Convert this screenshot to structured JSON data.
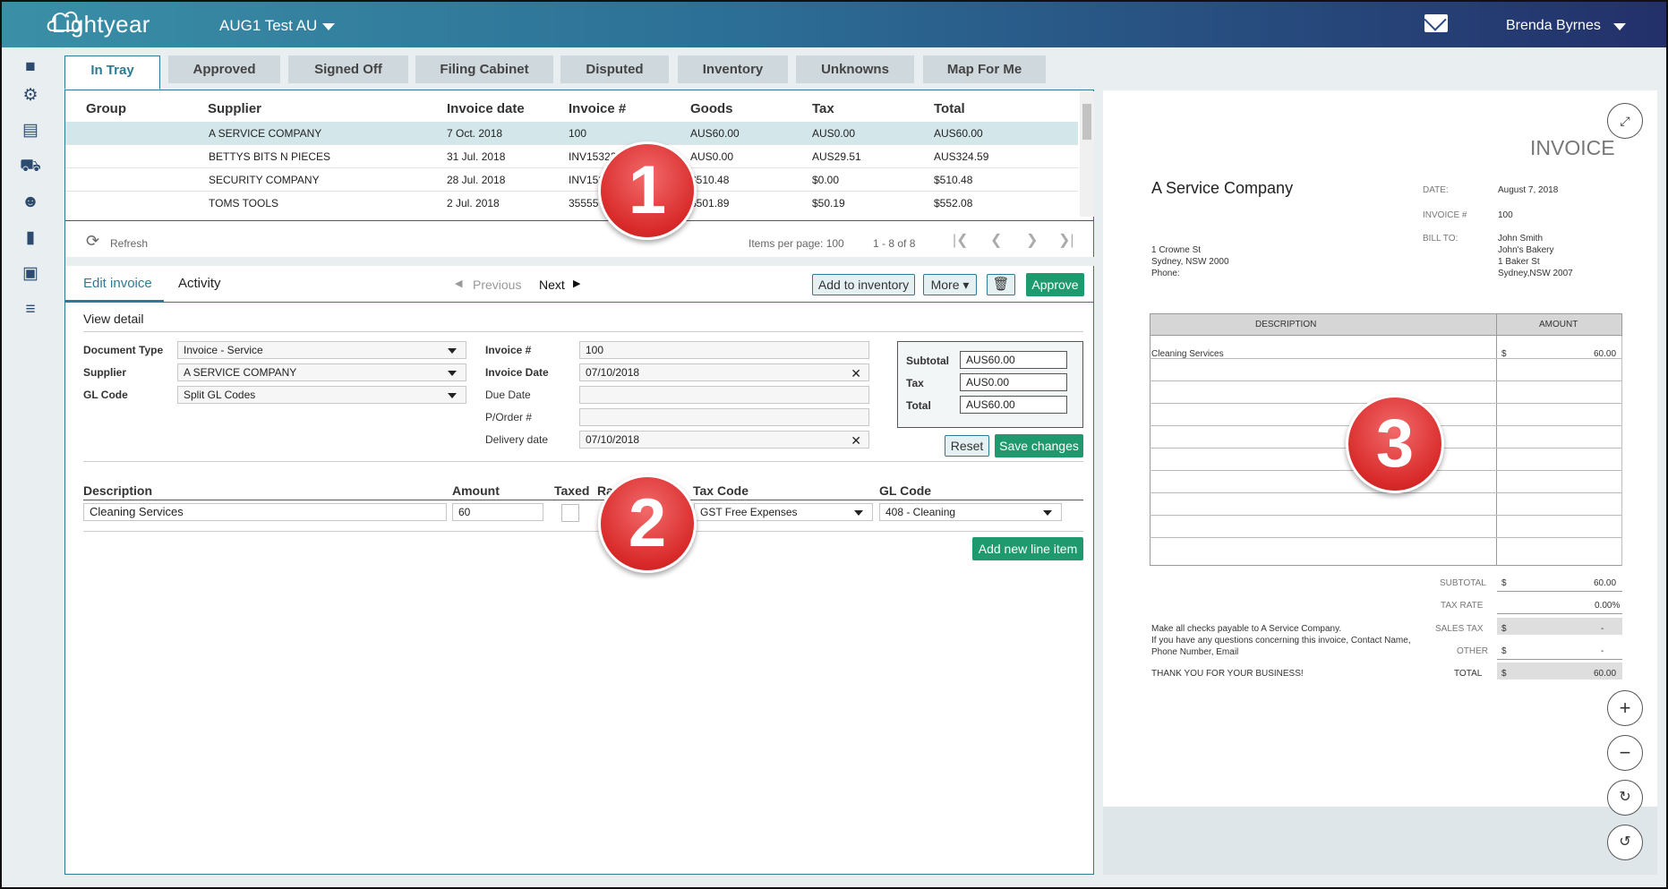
{
  "app": {
    "name": "Lightyear",
    "org": "AUG1 Test AU",
    "user": "Brenda Byrnes"
  },
  "tabs": [
    "In Tray",
    "Approved",
    "Signed Off",
    "Filing Cabinet",
    "Disputed",
    "Inventory",
    "Unknowns",
    "Map For Me"
  ],
  "table": {
    "headers": [
      "Group",
      "Supplier",
      "Invoice date",
      "Invoice #",
      "Goods",
      "Tax",
      "Total"
    ],
    "rows": [
      [
        "",
        "A SERVICE COMPANY",
        "7 Oct. 2018",
        "100",
        "AUS60.00",
        "AUS0.00",
        "AUS60.00"
      ],
      [
        "",
        "BETTYS BITS N PIECES",
        "31 Jul. 2018",
        "INV15322",
        "AUS0.00",
        "AUS29.51",
        "AUS324.59"
      ],
      [
        "",
        "SECURITY COMPANY",
        "28 Jul. 2018",
        "INV152",
        "$510.48",
        "$0.00",
        "$510.48"
      ],
      [
        "",
        "TOMS TOOLS",
        "2 Jul. 2018",
        "35555",
        "$501.89",
        "$50.19",
        "$552.08"
      ]
    ]
  },
  "pager": {
    "refresh": "Refresh",
    "items_per_page": "Items per page: 100",
    "range": "1 - 8 of 8"
  },
  "edit": {
    "tab_edit": "Edit invoice",
    "tab_activity": "Activity",
    "prev": "Previous",
    "next": "Next",
    "add_inventory": "Add to inventory",
    "more": "More",
    "approve": "Approve",
    "view_detail": "View detail",
    "doc_type_label": "Document Type",
    "doc_type": "Invoice - Service",
    "supplier_label": "Supplier",
    "supplier": "A SERVICE COMPANY",
    "gl_label": "GL Code",
    "gl": "Split GL Codes",
    "inv_no_label": "Invoice #",
    "inv_no": "100",
    "inv_date_label": "Invoice Date",
    "inv_date": "07/10/2018",
    "due_label": "Due Date",
    "porder_label": "P/Order #",
    "delivery_label": "Delivery date",
    "delivery": "07/10/2018",
    "subtotal_label": "Subtotal",
    "subtotal": "AUS60.00",
    "tax_label": "Tax",
    "tax": "AUS0.00",
    "total_label": "Total",
    "total": "AUS60.00",
    "reset": "Reset",
    "save": "Save changes"
  },
  "lines": {
    "h_desc": "Description",
    "h_amount": "Amount",
    "h_taxed": "Taxed",
    "h_rate": "Ra",
    "h_taxcode": "Tax Code",
    "h_gl": "GL Code",
    "desc": "Cleaning Services",
    "amount": "60",
    "taxcode": "GST Free Expenses",
    "gl": "408 - Cleaning",
    "add": "Add new line item"
  },
  "invoice": {
    "title": "INVOICE",
    "company": "A Service Company",
    "addr1": "1 Crowne St",
    "addr2": "Sydney, NSW 2000",
    "addr3": "Phone:",
    "date_label": "DATE:",
    "date": "August 7, 2018",
    "no_label": "INVOICE #",
    "no": "100",
    "bill_label": "BILL TO:",
    "bill1": "John Smith",
    "bill2": "John's Bakery",
    "bill3": "1 Baker St",
    "bill4": "Sydney,NSW 2007",
    "col_desc": "DESCRIPTION",
    "col_amt": "AMOUNT",
    "line_desc": "Cleaning Services",
    "line_cur": "$",
    "line_amt": "60.00",
    "subtotal_label": "SUBTOTAL",
    "subtotal_cur": "$",
    "subtotal": "60.00",
    "taxrate_label": "TAX RATE",
    "taxrate": "0.00%",
    "salestax_label": "SALES TAX",
    "salestax_cur": "$",
    "salestax": "-",
    "other_label": "OTHER",
    "other_cur": "$",
    "other": "-",
    "total_label": "TOTAL",
    "total_cur": "$",
    "total": "60.00",
    "note1": "Make all checks payable to A Service Company.",
    "note2": "If you have any questions concerning this invoice, Contact Name,",
    "note3": "Phone Number, Email",
    "thanks": "THANK YOU FOR YOUR BUSINESS!"
  },
  "markers": [
    "1",
    "2",
    "3"
  ]
}
